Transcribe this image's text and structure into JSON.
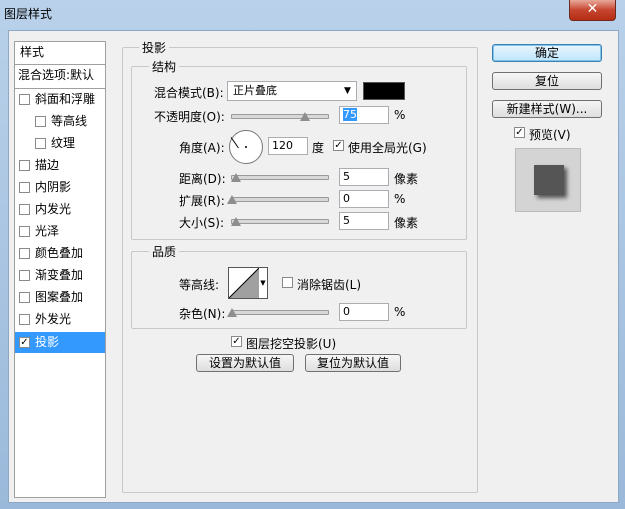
{
  "window": {
    "title": "图层样式",
    "close": "✕"
  },
  "left_panel": {
    "header": "样式",
    "blend_options": "混合选项:默认",
    "items": [
      {
        "label": "斜面和浮雕",
        "checked": false
      },
      {
        "label": "等高线",
        "checked": false
      },
      {
        "label": "纹理",
        "checked": false
      },
      {
        "label": "描边",
        "checked": false
      },
      {
        "label": "内阴影",
        "checked": false
      },
      {
        "label": "内发光",
        "checked": false
      },
      {
        "label": "光泽",
        "checked": false
      },
      {
        "label": "颜色叠加",
        "checked": false
      },
      {
        "label": "渐变叠加",
        "checked": false
      },
      {
        "label": "图案叠加",
        "checked": false
      },
      {
        "label": "外发光",
        "checked": false
      },
      {
        "label": "投影",
        "checked": true
      }
    ]
  },
  "drop_shadow": {
    "title": "投影",
    "structure": {
      "title": "结构",
      "blend_mode_label": "混合模式(B):",
      "blend_mode_value": "正片叠底",
      "opacity_label": "不透明度(O):",
      "opacity_value": "75",
      "percent": "%",
      "angle_label": "角度(A):",
      "angle_value": "120",
      "degree": "度",
      "global_light_label": "使用全局光(G)",
      "global_light_checked": true,
      "distance_label": "距离(D):",
      "distance_value": "5",
      "spread_label": "扩展(R):",
      "spread_value": "0",
      "size_label": "大小(S):",
      "size_value": "5",
      "pixels": "像素",
      "shadow_color": "#000000"
    },
    "quality": {
      "title": "品质",
      "contour_label": "等高线:",
      "antialias_label": "消除锯齿(L)",
      "antialias_checked": false,
      "noise_label": "杂色(N):",
      "noise_value": "0",
      "percent": "%"
    },
    "knockout_label": "图层挖空投影(U)",
    "knockout_checked": true,
    "make_default": "设置为默认值",
    "reset_default": "复位为默认值"
  },
  "right": {
    "ok": "确定",
    "reset": "复位",
    "new_style": "新建样式(W)...",
    "preview_label": "预览(V)",
    "preview_checked": true
  }
}
